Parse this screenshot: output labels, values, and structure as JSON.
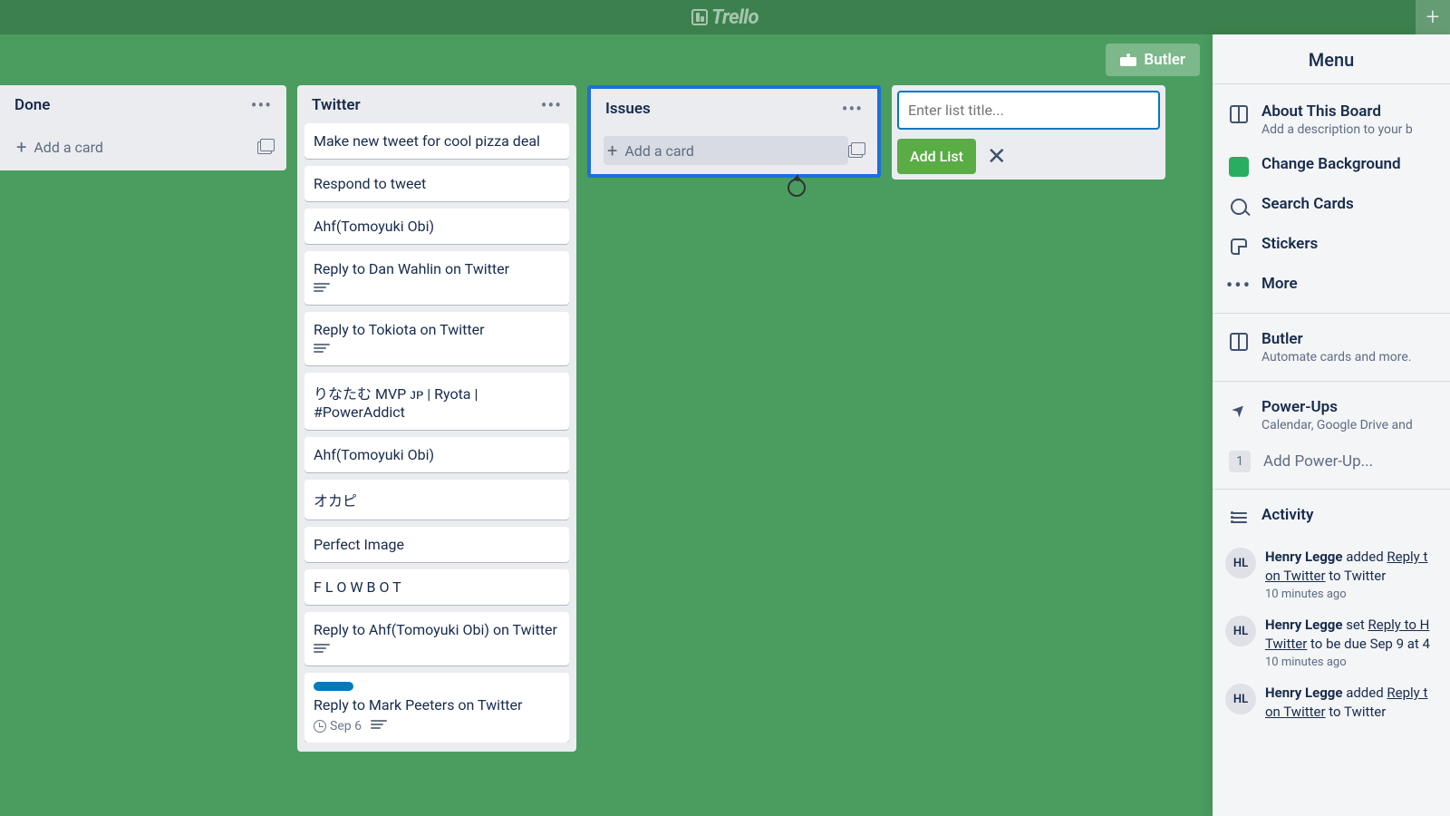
{
  "app": {
    "name": "Trello"
  },
  "header": {
    "butler": "Butler"
  },
  "menu": {
    "title": "Menu",
    "about": {
      "title": "About This Board",
      "sub": "Add a description to your b"
    },
    "changeBg": "Change Background",
    "search": "Search Cards",
    "stickers": "Stickers",
    "more": "More",
    "butler": {
      "title": "Butler",
      "sub": "Automate cards and more."
    },
    "powerups": {
      "title": "Power-Ups",
      "sub": "Calendar, Google Drive and",
      "count": "1",
      "add": "Add Power-Up..."
    },
    "activity": {
      "title": "Activity",
      "items": [
        {
          "initials": "HL",
          "user": "Henry Legge",
          "verb": "added",
          "link": "Reply t",
          "rest": "on Twitter",
          "tail": " to Twitter",
          "time": "10 minutes ago"
        },
        {
          "initials": "HL",
          "user": "Henry Legge",
          "verb": "set",
          "link": "Reply to H",
          "rest": "Twitter",
          "tail": " to be due Sep 9 at 4",
          "time": "10 minutes ago"
        },
        {
          "initials": "HL",
          "user": "Henry Legge",
          "verb": "added",
          "link": "Reply t",
          "rest": "on Twitter",
          "tail": " to Twitter",
          "time": ""
        }
      ]
    }
  },
  "lists": {
    "done": {
      "title": "Done",
      "addCard": "Add a card"
    },
    "twitter": {
      "title": "Twitter",
      "cards": [
        {
          "text": "Make new tweet for cool pizza deal"
        },
        {
          "text": "Respond to tweet"
        },
        {
          "text": "Ahf(Tomoyuki Obi)"
        },
        {
          "text": "Reply to Dan Wahlin on Twitter",
          "desc": true
        },
        {
          "text": "Reply to Tokiota on Twitter",
          "desc": true
        },
        {
          "text": "りなたむ MVP ᴊᴘ | Ryota | #PowerAddict"
        },
        {
          "text": "Ahf(Tomoyuki Obi)"
        },
        {
          "text": "オカピ"
        },
        {
          "text": "Perfect Image"
        },
        {
          "text": "F L O W B O T"
        },
        {
          "text": "Reply to Ahf(Tomoyuki Obi) on Twitter",
          "desc": true
        },
        {
          "text": "Reply to Mark Peeters on Twitter",
          "label": true,
          "due": "Sep 6",
          "desc2": true
        }
      ]
    },
    "issues": {
      "title": "Issues",
      "addCard": "Add a card"
    }
  },
  "newList": {
    "placeholder": "Enter list title...",
    "addBtn": "Add List"
  }
}
